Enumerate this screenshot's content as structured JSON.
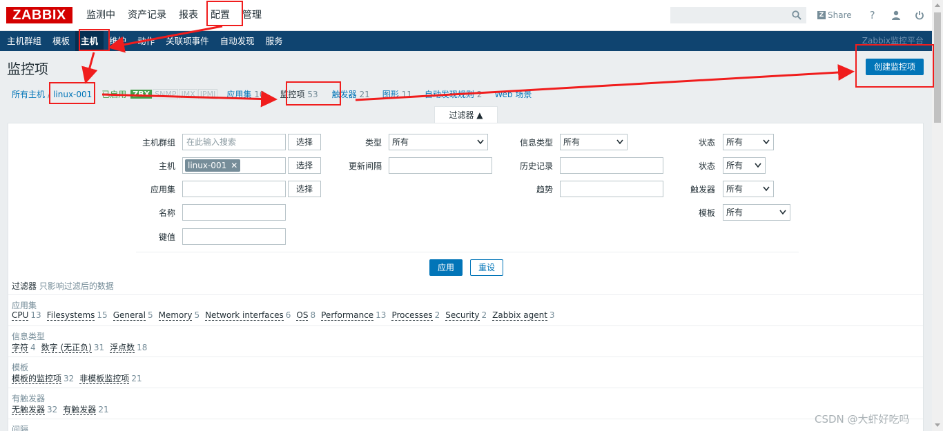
{
  "header": {
    "logo": "ZABBIX",
    "menu": [
      "监测中",
      "资产记录",
      "报表",
      "配置",
      "管理"
    ],
    "search_placeholder": "",
    "share_label": "Share",
    "help_icon": "help-icon",
    "user_icon": "user-icon",
    "logout_icon": "power-icon"
  },
  "submenu": {
    "items": [
      "主机群组",
      "模板",
      "主机",
      "维护",
      "动作",
      "关联项事件",
      "自动发现",
      "服务"
    ],
    "active": "主机",
    "server_name": "Zabbix监控平台"
  },
  "page": {
    "title": "监控项",
    "create_button": "创建监控项"
  },
  "hostnav": {
    "all_hosts": "所有主机",
    "separator": "/",
    "host": "linux-001",
    "enabled": "已启用",
    "zbx": "ZBX",
    "snmp": "SNMP",
    "jmx": "JMX",
    "ipmi": "IPMI",
    "tabs": [
      {
        "label": "应用集",
        "count": "10"
      },
      {
        "label": "监控项",
        "count": "53"
      },
      {
        "label": "触发器",
        "count": "21"
      },
      {
        "label": "图形",
        "count": "11"
      },
      {
        "label": "自动发现规则",
        "count": "2"
      },
      {
        "label": "Web 场景",
        "count": ""
      }
    ]
  },
  "filter": {
    "tab_label": "过滤器 ▲",
    "host_group_label": "主机群组",
    "host_group_placeholder": "在此输入搜索",
    "select_label": "选择",
    "host_label": "主机",
    "host_chip": "linux-001",
    "application_label": "应用集",
    "name_label": "名称",
    "key_label": "键值",
    "type_label": "类型",
    "type_value": "所有",
    "update_interval_label": "更新间隔",
    "info_type_label": "信息类型",
    "info_type_value": "所有",
    "history_label": "历史记录",
    "trends_label": "趋势",
    "state_label": "状态",
    "state_value": "所有",
    "status_label": "状态",
    "status_value": "所有",
    "triggers_label": "触发器",
    "triggers_value": "所有",
    "template_label": "模板",
    "template_value": "所有",
    "apply": "应用",
    "reset": "重设"
  },
  "subfilter": {
    "title": "过滤器",
    "hint": "只影响过滤后的数据",
    "groups": [
      {
        "title": "应用集",
        "items": [
          {
            "label": "CPU",
            "count": "13"
          },
          {
            "label": "Filesystems",
            "count": "15"
          },
          {
            "label": "General",
            "count": "5"
          },
          {
            "label": "Memory",
            "count": "5"
          },
          {
            "label": "Network interfaces",
            "count": "6"
          },
          {
            "label": "OS",
            "count": "8"
          },
          {
            "label": "Performance",
            "count": "13"
          },
          {
            "label": "Processes",
            "count": "2"
          },
          {
            "label": "Security",
            "count": "2"
          },
          {
            "label": "Zabbix agent",
            "count": "3"
          }
        ]
      },
      {
        "title": "信息类型",
        "items": [
          {
            "label": "字符",
            "count": "4"
          },
          {
            "label": "数字 (无正负)",
            "count": "31"
          },
          {
            "label": "浮点数",
            "count": "18"
          }
        ]
      },
      {
        "title": "模板",
        "items": [
          {
            "label": "模板的监控项",
            "count": "32"
          },
          {
            "label": "非模板监控项",
            "count": "21"
          }
        ]
      },
      {
        "title": "有触发器",
        "items": [
          {
            "label": "无触发器",
            "count": "32"
          },
          {
            "label": "有触发器",
            "count": "21"
          }
        ]
      },
      {
        "title": "间隔",
        "items": []
      }
    ]
  },
  "watermark": "CSDN @大虾好吃吗",
  "colors": {
    "brand": "#d40000",
    "nav": "#0f4470",
    "accent": "#0275b8",
    "annotation": "#f01d1d"
  }
}
